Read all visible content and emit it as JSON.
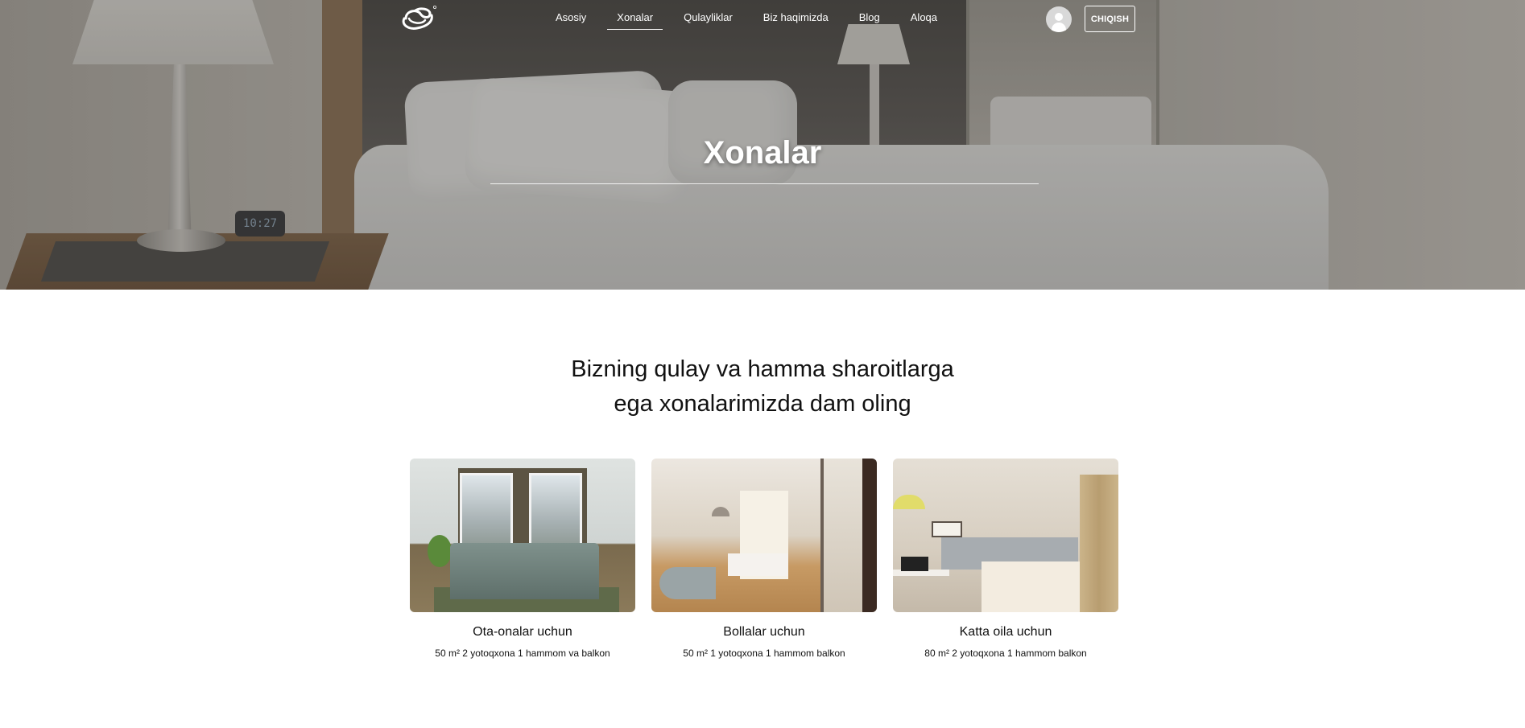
{
  "nav": {
    "links": [
      {
        "label": "Asosiy",
        "active": false
      },
      {
        "label": "Xonalar",
        "active": true
      },
      {
        "label": "Qulayliklar",
        "active": false
      },
      {
        "label": "Biz haqimizda",
        "active": false
      },
      {
        "label": "Blog",
        "active": false
      },
      {
        "label": "Aloqa",
        "active": false
      }
    ],
    "logout_label": "CHIQISH",
    "icons": {
      "logo": "loop-logo-icon",
      "user": "user-avatar-icon"
    }
  },
  "hero": {
    "title": "Xonalar",
    "clock_text": "10:27"
  },
  "intro": {
    "line1": "Bizning qulay va hamma sharoitlarga",
    "line2": "ega xonalarimizda dam oling"
  },
  "rooms": [
    {
      "title": "Ota-onalar uchun",
      "desc": "50 m² 2 yotoqxona 1 hammom va balkon"
    },
    {
      "title": "Bollalar uchun",
      "desc": "50 m² 1 yotoqxona 1 hammom balkon"
    },
    {
      "title": "Katta oila uchun",
      "desc": "80 m² 2 yotoqxona 1 hammom balkon"
    }
  ],
  "colors": {
    "hero_text": "#ffffff",
    "body_text": "#111111",
    "background": "#ffffff"
  }
}
